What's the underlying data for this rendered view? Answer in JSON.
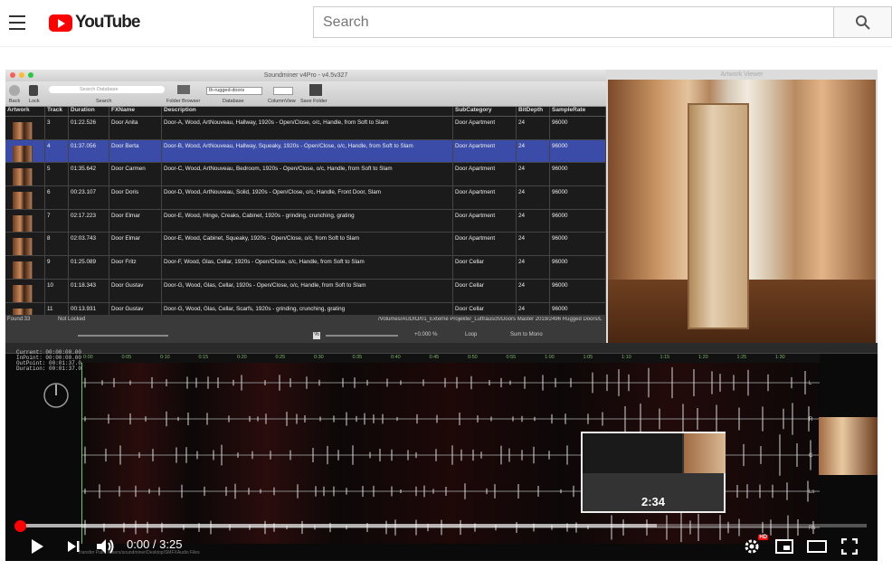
{
  "header": {
    "logo_text": "YouTube",
    "search_placeholder": "Search"
  },
  "soundminer": {
    "title": "Soundminer v4Pro - v4.5v327",
    "toolbar": {
      "back": "Back",
      "lock": "Lock",
      "search_placeholder": "Search Database",
      "search_label": "Search",
      "folder_browser": "Folder Browser",
      "database_value": "th-rugged-doors",
      "database_label": "Database",
      "column_view_label": "ColumnView",
      "save_folder": "Save Folder"
    },
    "columns": [
      "Artwork",
      "Track",
      "Duration",
      "FXName",
      "Description",
      "SubCategory",
      "BitDepth",
      "SampleRate"
    ],
    "rows": [
      {
        "track": "3",
        "duration": "01:22.526",
        "fxname": "Door Anita",
        "description": "Door-A, Wood, ArtNouveau, Hallway, 1920s - Open/Close, o/c, Handle, from Soft to Slam",
        "subcategory": "Door Apartment",
        "bitdepth": "24",
        "samplerate": "96000"
      },
      {
        "track": "4",
        "duration": "01:37.056",
        "fxname": "Door Berta",
        "description": "Door-B, Wood, ArtNouveau, Hallway, Squeaky, 1920s - Open/Close, o/c, Handle, from Soft to Slam",
        "subcategory": "Door Apartment",
        "bitdepth": "24",
        "samplerate": "96000"
      },
      {
        "track": "5",
        "duration": "01:35.642",
        "fxname": "Door Carmen",
        "description": "Door-C, Wood, ArtNouveau, Bedroom, 1920s - Open/Close, o/c, Handle, from Soft to Slam",
        "subcategory": "Door Apartment",
        "bitdepth": "24",
        "samplerate": "96000"
      },
      {
        "track": "6",
        "duration": "00:23.107",
        "fxname": "Door Doris",
        "description": "Door-D, Wood, ArtNouveau, Solid, 1920s - Open/Close, o/c, Handle, Front Door, Slam",
        "subcategory": "Door Apartment",
        "bitdepth": "24",
        "samplerate": "96000"
      },
      {
        "track": "7",
        "duration": "02:17.223",
        "fxname": "Door Elmar",
        "description": "Door-E, Wood, Hinge, Creaks, Cabinet, 1920s - grinding, crunching, grating",
        "subcategory": "Door Apartment",
        "bitdepth": "24",
        "samplerate": "96000"
      },
      {
        "track": "8",
        "duration": "02:03.743",
        "fxname": "Door Elmar",
        "description": "Door-E, Wood, Cabinet, Squeaky, 1920s - Open/Close, o/c, from Soft to Slam",
        "subcategory": "Door Apartment",
        "bitdepth": "24",
        "samplerate": "96000"
      },
      {
        "track": "9",
        "duration": "01:25.089",
        "fxname": "Door Fritz",
        "description": "Door-F, Wood, Glas, Cellar, 1920s - Open/Close, o/c, Handle, from Soft to Slam",
        "subcategory": "Door Cellar",
        "bitdepth": "24",
        "samplerate": "96000"
      },
      {
        "track": "10",
        "duration": "01:18.343",
        "fxname": "Door Gustav",
        "description": "Door-G, Wood, Glas, Cellar, 1920s - Open/Close, o/c, Handle, from Soft to Slam",
        "subcategory": "Door Cellar",
        "bitdepth": "24",
        "samplerate": "96000"
      },
      {
        "track": "11",
        "duration": "00:13.931",
        "fxname": "Door Gustav",
        "description": "Door-G, Wood, Glas, Cellar, Scarfs, 1920s - grinding, crunching, grating",
        "subcategory": "Door Cellar",
        "bitdepth": "24",
        "samplerate": "96000"
      }
    ],
    "status": {
      "found": "Found:33",
      "not_locked": "Not Locked",
      "path": "/Volumes/AUDIO/01_Externe Projekte/_Luftrausch/Doors Master 2019/2496 Rugged Doors/L",
      "pitch": "+0.000 %",
      "loop": "Loop",
      "sum_to_mono": "Sum to Mono"
    },
    "artwork_viewer_title": "Artwork Viewer",
    "info": {
      "current": "Current: 00:00:00.00",
      "inpoint": "InPoint: 00:00:00.00",
      "outpoint": "OutPoint: 00:01:37.01",
      "duration": "Duration: 00:01:37.01"
    },
    "ruler_ticks": [
      "0:00",
      "0:05",
      "0:10",
      "0:15",
      "0:20",
      "0:25",
      "0:30",
      "0:35",
      "0:40",
      "0:45",
      "0:50",
      "0:55",
      "1:00",
      "1:05",
      "1:10",
      "1:15",
      "1:20",
      "1:25",
      "1:30"
    ],
    "channel_labels": [
      "L",
      "R",
      "C",
      "Ls",
      "Rs"
    ],
    "bottom_text": "Transfer Path: /Users/soundminer/Desktop/SMFXAudio Files"
  },
  "player": {
    "time_display": "0:00 / 3:25",
    "hover_time": "2:34",
    "hd_badge": "HD",
    "progress_fraction": 0.0,
    "buffered_fraction": 0.752
  },
  "colors": {
    "youtube_red": "#ff0000",
    "selected_row": "#3a4ca8"
  }
}
